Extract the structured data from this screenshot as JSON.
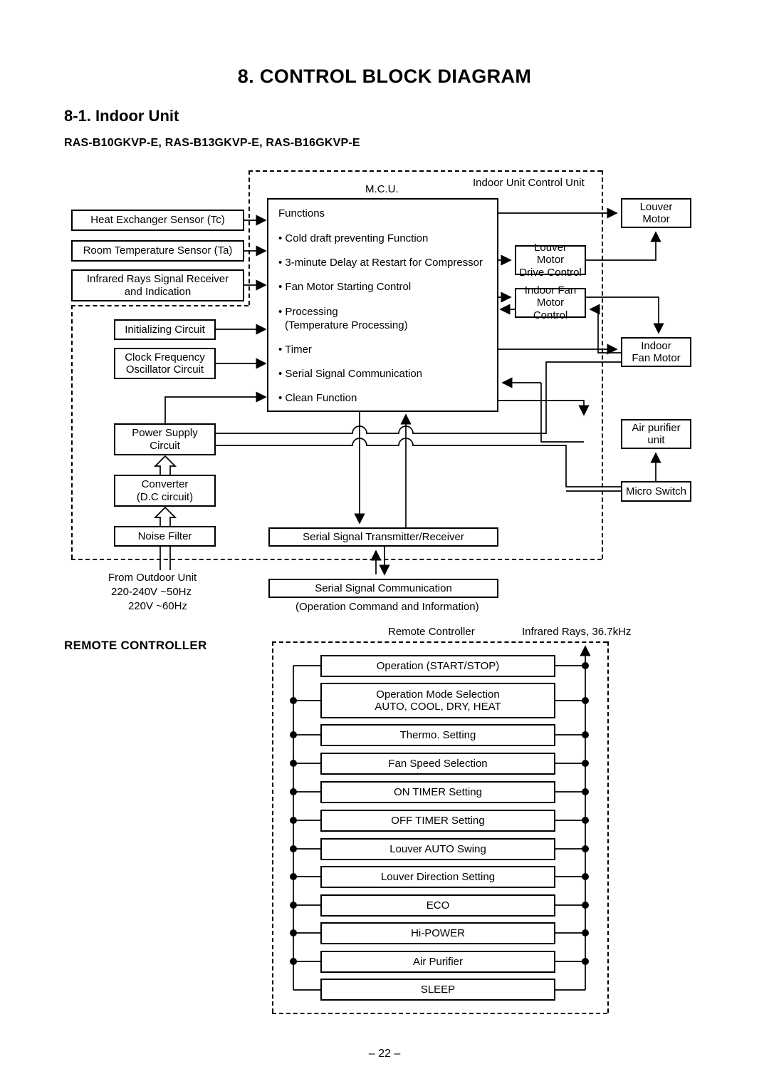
{
  "document": {
    "title": "8.  CONTROL BLOCK DIAGRAM",
    "section_title": "8-1.  Indoor Unit",
    "models": "RAS-B10GKVP-E, RAS-B13GKVP-E, RAS-B16GKVP-E",
    "page_number": "– 22 –"
  },
  "diagram": {
    "enclosure_labels": {
      "indoor_unit_control_unit": "Indoor Unit Control Unit",
      "mcu": "M.C.U.",
      "remote_controller": "Remote Controller",
      "infrared": "Infrared Rays, 36.7kHz"
    },
    "mcu": {
      "header": "Functions",
      "functions": [
        "Cold draft preventing Function",
        "3-minute Delay at Restart for Compressor",
        "Fan Motor Starting Control",
        "Processing",
        "(Temperature Processing)",
        "Timer",
        "Serial Signal Communication",
        "Clean Function"
      ]
    },
    "inputs": [
      {
        "label": "Heat Exchanger Sensor (Tc)"
      },
      {
        "label": "Room Temperature Sensor (Ta)"
      },
      {
        "label": "Infrared Rays Signal Receiver\nand Indication"
      },
      {
        "label": "Initializing Circuit"
      },
      {
        "label": "Clock Frequency\nOscillator Circuit"
      }
    ],
    "power_chain": [
      {
        "label": "Power Supply\nCircuit"
      },
      {
        "label": "Converter\n(D.C circuit)"
      },
      {
        "label": "Noise Filter"
      }
    ],
    "power_source": {
      "line1": "From Outdoor Unit",
      "line2": "220-240V  ~50Hz",
      "line3": "220V  ~60Hz"
    },
    "outputs": [
      {
        "label": "Louver\nMotor"
      },
      {
        "label": "Louver Motor\nDrive Control"
      },
      {
        "label": "Indoor Fan\nMotor Control"
      },
      {
        "label": "Indoor\nFan Motor"
      },
      {
        "label": "Air purifier\nunit"
      },
      {
        "label": "Micro Switch"
      }
    ],
    "serial": {
      "transmitter": "Serial Signal Transmitter/Receiver",
      "communication": "Serial Signal Communication",
      "communication_sub": "(Operation Command and Information)"
    }
  },
  "remote_controller": {
    "heading": "REMOTE CONTROLLER",
    "items": [
      {
        "label": "Operation (START/STOP)"
      },
      {
        "label": "Operation Mode Selection\nAUTO, COOL, DRY, HEAT"
      },
      {
        "label": "Thermo. Setting"
      },
      {
        "label": "Fan Speed Selection"
      },
      {
        "label": "ON TIMER Setting"
      },
      {
        "label": "OFF TIMER Setting"
      },
      {
        "label": "Louver AUTO Swing"
      },
      {
        "label": "Louver Direction Setting"
      },
      {
        "label": "ECO"
      },
      {
        "label": "Hi-POWER"
      },
      {
        "label": "Air Purifier"
      },
      {
        "label": "SLEEP"
      }
    ]
  }
}
